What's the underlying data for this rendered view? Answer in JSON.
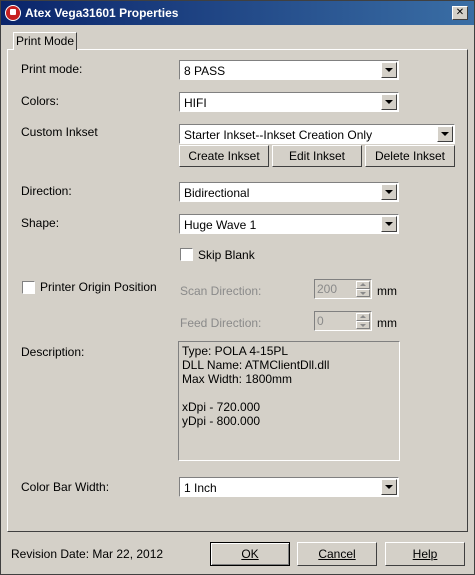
{
  "window": {
    "title": "Atex Vega31601 Properties",
    "close_label": "✕"
  },
  "tab": {
    "label": "Print Mode"
  },
  "print_mode": {
    "label": "Print mode:",
    "value": "8 PASS"
  },
  "colors": {
    "label": "Colors:",
    "value": "HIFI"
  },
  "custom_inkset": {
    "label": "Custom Inkset",
    "value": "Starter Inkset--Inkset Creation Only"
  },
  "inkset_buttons": {
    "create": "Create Inkset",
    "edit": "Edit Inkset",
    "delete": "Delete Inkset"
  },
  "direction": {
    "label": "Direction:",
    "value": "Bidirectional"
  },
  "shape": {
    "label": "Shape:",
    "value": "Huge Wave 1"
  },
  "skip_blank": {
    "label": "Skip Blank",
    "checked": false
  },
  "printer_origin": {
    "label": "Printer Origin Position",
    "checked": false
  },
  "scan_direction": {
    "label": "Scan Direction:",
    "value": "200",
    "unit": "mm"
  },
  "feed_direction": {
    "label": "Feed Direction:",
    "value": "0",
    "unit": "mm"
  },
  "description": {
    "label": "Description:",
    "lines": [
      "Type: POLA 4-15PL",
      "DLL Name: ATMClientDll.dll",
      "Max Width: 1800mm",
      "",
      "xDpi - 720.000",
      "yDpi - 800.000"
    ]
  },
  "color_bar_width": {
    "label": "Color Bar Width:",
    "value": "1 Inch"
  },
  "footer": {
    "revision": "Revision Date: Mar 22, 2012",
    "ok": "OK",
    "cancel": "Cancel",
    "help": "Help"
  }
}
